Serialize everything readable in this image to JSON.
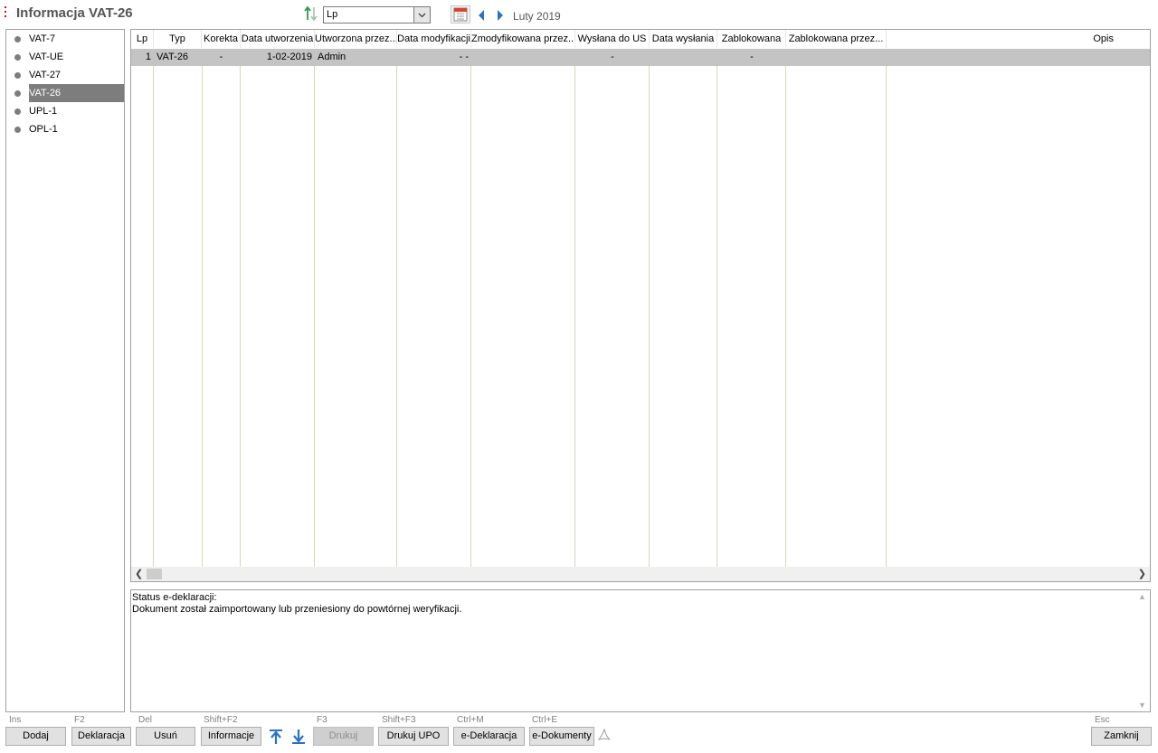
{
  "header": {
    "title": "Informacja VAT-26",
    "sort_value": "Lp",
    "period": "Luty 2019"
  },
  "left_list": {
    "items": [
      {
        "label": "VAT-7",
        "selected": false
      },
      {
        "label": "VAT-UE",
        "selected": false
      },
      {
        "label": "VAT-27",
        "selected": false
      },
      {
        "label": "VAT-26",
        "selected": true
      },
      {
        "label": "UPL-1",
        "selected": false
      },
      {
        "label": "OPL-1",
        "selected": false
      }
    ]
  },
  "grid": {
    "columns": [
      "Lp",
      "Typ",
      "Korekta",
      "Data utworzenia",
      "Utworzona przez...",
      "Data modyfikacji",
      "Zmodyfikowana przez...",
      "Wysłana do US",
      "Data wysłania",
      "Zablokowana",
      "Zablokowana przez...",
      "Opis"
    ],
    "rows": [
      [
        "1",
        "VAT-26",
        "-",
        "1-02-2019",
        "Admin",
        "- -",
        "",
        "-",
        "",
        "-",
        "",
        ""
      ]
    ]
  },
  "status": {
    "line1": "Status e-deklaracji:",
    "line2": "Dokument został zaimportowany lub przeniesiony do powtórnej weryfikacji."
  },
  "footer": {
    "shortcuts": {
      "dodaj": "Ins",
      "deklaracja": "F2",
      "usun": "Del",
      "informacje": "Shift+F2",
      "drukuj": "F3",
      "drukuj_upo": "Shift+F3",
      "e_deklaracja": "Ctrl+M",
      "e_dokumenty": "Ctrl+E",
      "zamknij": "Esc"
    },
    "buttons": {
      "dodaj": "Dodaj",
      "deklaracja": "Deklaracja",
      "usun": "Usuń",
      "informacje": "Informacje",
      "drukuj": "Drukuj",
      "drukuj_upo": "Drukuj UPO",
      "e_deklaracja": "e-Deklaracja",
      "e_dokumenty": "e-Dokumenty",
      "zamknij": "Zamknij"
    }
  },
  "colors": {
    "selection": "#7d7d7d",
    "row_selected": "#c4c4c4",
    "column_line": "#d9d6b8",
    "accent_arrow": "#2b73c2"
  }
}
